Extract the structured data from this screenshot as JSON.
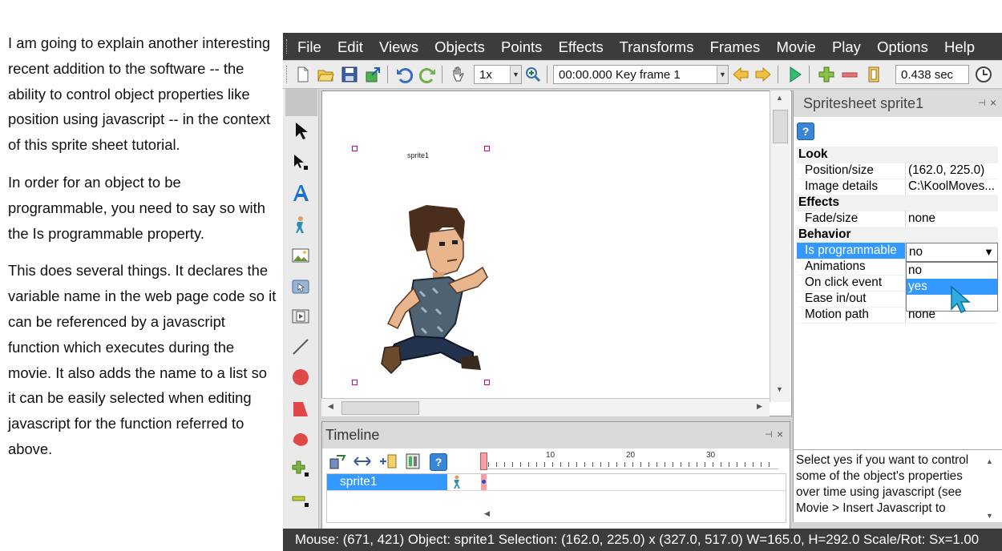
{
  "tutorial": {
    "paragraphs": [
      "I am going to explain another interesting recent addition to the software -- the ability to control object properties like position using javascript -- in the context of this sprite sheet tutorial.",
      "In order for an object to be programmable, you need to say so with the Is programmable property.",
      "This does several things. It declares the variable name in the web page code so it can be referenced by a javascript function which executes during the movie. It also adds the name to a list so it can be easily selected when editing javascript for the function referred to above."
    ]
  },
  "menu": [
    "File",
    "Edit",
    "Views",
    "Objects",
    "Points",
    "Effects",
    "Transforms",
    "Frames",
    "Movie",
    "Play",
    "Options",
    "Help"
  ],
  "toolbar": {
    "zoom": "1x",
    "frame_select": "00:00.000  Key frame 1",
    "duration": "0.438 sec"
  },
  "stage": {
    "sprite_label": "sprite1"
  },
  "timeline": {
    "title": "Timeline",
    "ticks": [
      "10",
      "20",
      "30"
    ],
    "row_label": "sprite1"
  },
  "properties": {
    "title": "Spritesheet sprite1",
    "rows": [
      {
        "type": "cat",
        "name": "Look"
      },
      {
        "type": "prop",
        "name": "Position/size",
        "value": "(162.0, 225.0)"
      },
      {
        "type": "prop",
        "name": "Image details",
        "value": "C:\\KoolMoves..."
      },
      {
        "type": "cat",
        "name": "Effects"
      },
      {
        "type": "prop",
        "name": "Fade/size",
        "value": "none"
      },
      {
        "type": "cat",
        "name": "Behavior"
      },
      {
        "type": "prop",
        "name": "Is programmable",
        "value": "no",
        "selected": true
      },
      {
        "type": "prop",
        "name": "Animations",
        "value": ""
      },
      {
        "type": "prop",
        "name": "On click event",
        "value": ""
      },
      {
        "type": "prop",
        "name": "Ease in/out",
        "value": ""
      },
      {
        "type": "prop",
        "name": "Motion path",
        "value": "none"
      }
    ],
    "dropdown": {
      "current": "no",
      "options": [
        "no",
        "yes"
      ],
      "highlighted": "yes"
    },
    "description": "Select yes if you want to control some of the object's properties over time using javascript (see Movie > Insert Javascript to"
  },
  "status": "Mouse: (671, 421)  Object: sprite1  Selection: (162.0, 225.0) x (327.0, 517.0)  W=165.0,  H=292.0  Scale/Rot: Sx=1.00",
  "colors": {
    "selection": "#3399ff",
    "dark_bar": "#3c3c3c",
    "handle": "#d6007a"
  }
}
